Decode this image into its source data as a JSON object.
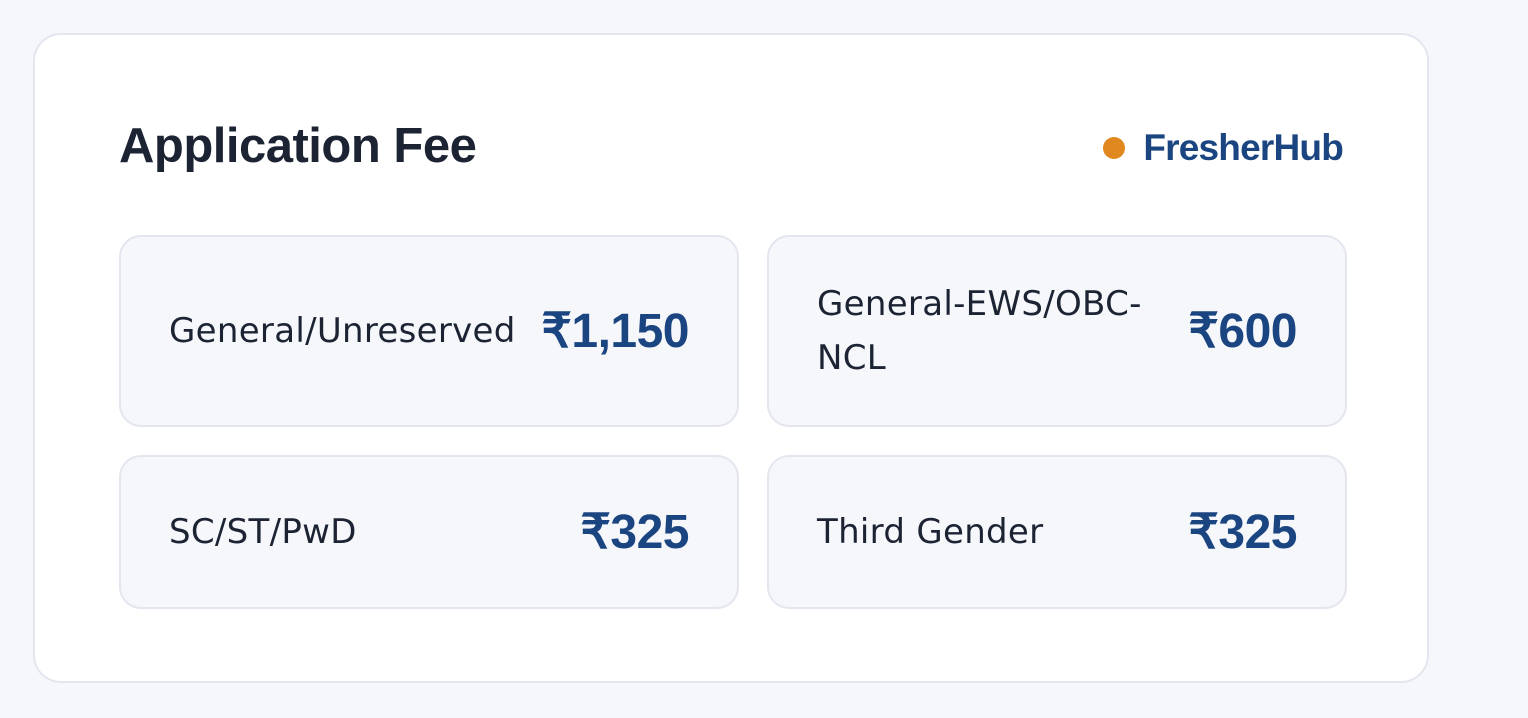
{
  "card": {
    "title": "Application Fee",
    "brand": "FresherHub"
  },
  "colors": {
    "accent": "#1a4580",
    "brand_dot": "#e0881f",
    "text": "#1c2333",
    "tile_bg": "#f5f7fb",
    "border": "#e3e6ee"
  },
  "fees": [
    {
      "category": "General/Unreserved",
      "amount": "₹1,150"
    },
    {
      "category": "General-EWS/OBC-NCL",
      "amount": "₹600"
    },
    {
      "category": "SC/ST/PwD",
      "amount": "₹325"
    },
    {
      "category": "Third Gender",
      "amount": "₹325"
    }
  ]
}
